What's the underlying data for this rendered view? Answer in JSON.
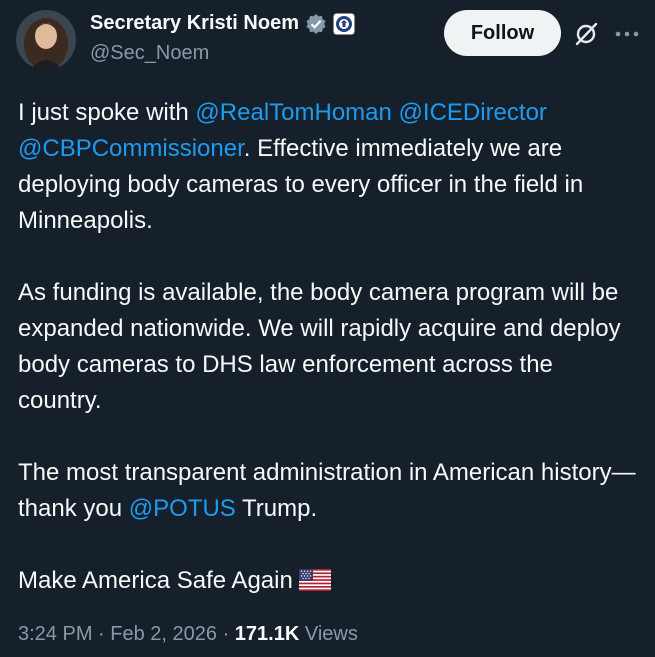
{
  "author": {
    "display_name": "Secretary Kristi Noem",
    "handle": "@Sec_Noem",
    "verified": true
  },
  "actions": {
    "follow_label": "Follow"
  },
  "tweet": {
    "p1_part1": "I just spoke with ",
    "mention_1": "@RealTomHoman",
    "space_1": " ",
    "mention_2": "@ICEDirector",
    "space_2": " ",
    "mention_3": "@CBPCommissioner",
    "p1_part2": ". Effective immediately we are deploying body cameras to every officer in the field in Minneapolis.",
    "p2": "As funding is available, the body camera program will be expanded nationwide. We will rapidly acquire and deploy body cameras to DHS law enforcement across the country.",
    "p3_part1": "The most transparent administration in American history—thank you ",
    "mention_4": "@POTUS",
    "p3_part2": " Trump.",
    "p4": "Make America Safe Again "
  },
  "meta": {
    "time": "3:24 PM",
    "separator": " · ",
    "date": "Feb 2, 2026",
    "views_count": "171.1K",
    "views_label": " Views"
  },
  "colors": {
    "background": "#15202b",
    "text": "#f7f9f9",
    "secondary": "#8b98a5",
    "link": "#1d9bf0",
    "follow_bg": "#eff3f4"
  },
  "icons": {
    "verified": "verified-badge-icon",
    "affiliate": "dhs-seal-icon",
    "grok": "grok-icon",
    "more": "more-dots-icon",
    "flag": "us-flag-icon"
  }
}
